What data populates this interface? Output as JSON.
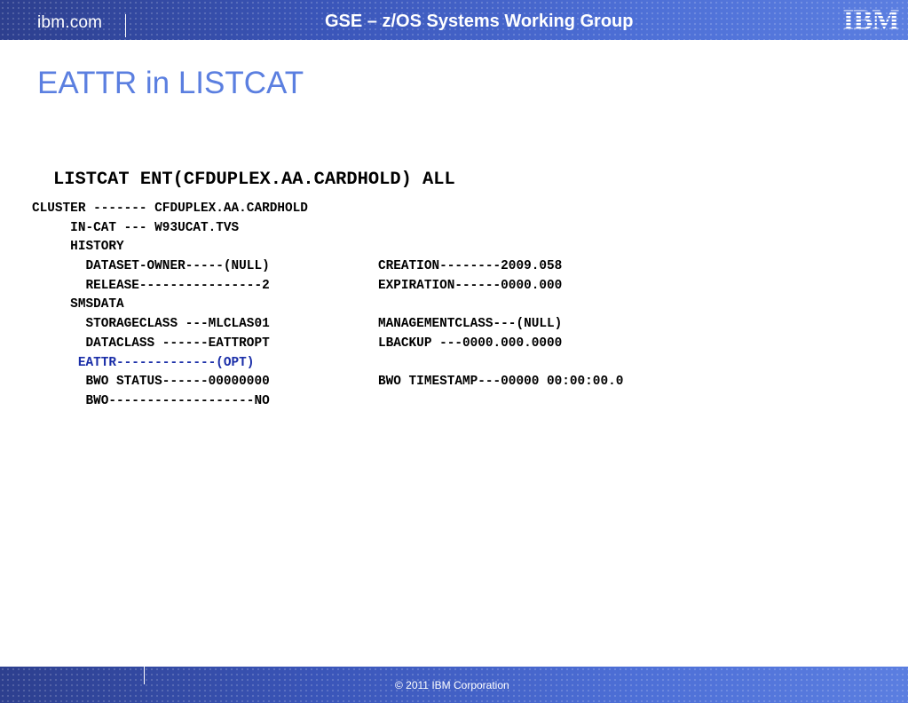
{
  "header": {
    "site": "ibm.com",
    "deck_title": "GSE – z/OS Systems Working Group",
    "logo_text": "IBM"
  },
  "slide": {
    "title": "EATTR in LISTCAT",
    "command": "LISTCAT ENT(CFDUPLEX.AA.CARDHOLD) ALL"
  },
  "listing": {
    "lines": [
      {
        "left": "CLUSTER ------- CFDUPLEX.AA.CARDHOLD",
        "right": ""
      },
      {
        "left": "     IN-CAT --- W93UCAT.TVS",
        "right": ""
      },
      {
        "left": "     HISTORY",
        "right": ""
      },
      {
        "left": "       DATASET-OWNER-----(NULL)",
        "right": "CREATION--------2009.058"
      },
      {
        "left": "       RELEASE----------------2",
        "right": "EXPIRATION------0000.000"
      },
      {
        "left": "     SMSDATA",
        "right": ""
      },
      {
        "left": "       STORAGECLASS ---MLCLAS01",
        "right": "MANAGEMENTCLASS---(NULL)"
      },
      {
        "left": "       DATACLASS ------EATTROPT",
        "right": "LBACKUP ---0000.000.0000"
      },
      {
        "left": "      EATTR-------------(OPT)",
        "right": "",
        "highlight": true
      },
      {
        "left": "       BWO STATUS------00000000",
        "right": "BWO TIMESTAMP---00000 00:00:00.0"
      },
      {
        "left": "       BWO-------------------NO",
        "right": ""
      }
    ]
  },
  "footer": {
    "copyright": "© 2011 IBM Corporation"
  },
  "colors": {
    "bar": "#3a55b8",
    "title": "#5b7fe0",
    "highlight": "#1a2ea8"
  }
}
